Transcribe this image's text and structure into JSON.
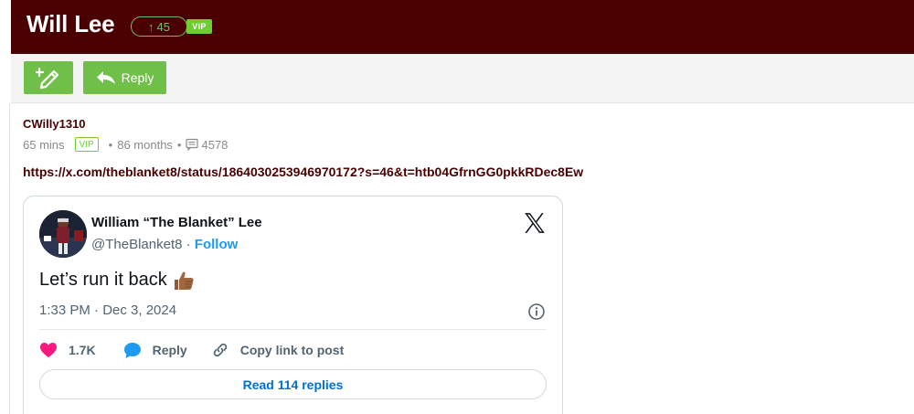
{
  "header": {
    "title": "Will Lee",
    "upvote_count": "45",
    "vip_label": "VIP"
  },
  "toolbar": {
    "reply_label": "Reply"
  },
  "post": {
    "username": "CWilly1310",
    "time_ago": "65 mins",
    "vip_label": "VIP",
    "membership": "86 months",
    "post_count": "4578",
    "link": "https://x.com/theblanket8/status/1864030253946970172?s=46&t=htb04GfrnGG0pkkRDec8Ew"
  },
  "tweet": {
    "author_name": "William “The Blanket” Lee",
    "handle": "@TheBlanket8",
    "separator": " · ",
    "follow_label": "Follow",
    "text": "Let’s run it back",
    "timestamp": "1:33 PM · Dec 3, 2024",
    "likes": "1.7K",
    "reply_label": "Reply",
    "copy_link_label": "Copy link to post",
    "read_replies_label": "Read 114 replies"
  },
  "colors": {
    "header_bg": "#4a0001",
    "button_green": "#6fbf48",
    "vip_green": "#6fcd31",
    "upvote_green": "#6ec26e",
    "link_color": "#4a0001",
    "tweet_blue": "#1d9bf0",
    "like_pink": "#f91880"
  },
  "icons": {
    "new_post": "pencil-plus-icon",
    "reply": "reply-arrow-icon",
    "messages": "message-icon",
    "x_logo": "x-logo-icon",
    "info": "info-icon",
    "like": "heart-icon",
    "reply_bubble": "speech-bubble-icon",
    "copy_link": "link-icon",
    "emoji": "thumbs-up-emoji"
  }
}
